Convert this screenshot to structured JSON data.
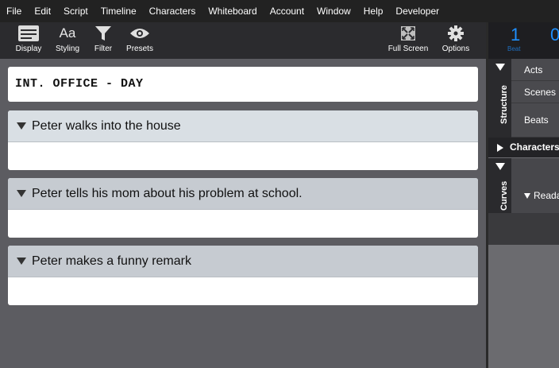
{
  "menu": [
    "File",
    "Edit",
    "Script",
    "Timeline",
    "Characters",
    "Whiteboard",
    "Account",
    "Window",
    "Help",
    "Developer"
  ],
  "toolbar": {
    "display": "Display",
    "styling": "Styling",
    "styling_icon_text": "Aa",
    "filter": "Filter",
    "presets": "Presets",
    "fullscreen": "Full Screen",
    "options": "Options"
  },
  "scene_heading": "INT. OFFICE - DAY",
  "beats": [
    "Peter walks into the house",
    "Peter tells his mom about his problem at school.",
    "Peter makes a funny remark"
  ],
  "stats": {
    "beat_count": "1",
    "second_count": "0",
    "beat_label": "Beat"
  },
  "panel": {
    "structure_tab": "Structure",
    "rows": [
      "Acts",
      "Scenes",
      "Beats"
    ],
    "characters": "Characters",
    "curves_tab": "Curves",
    "readability": "Reada"
  },
  "colors": {
    "accent": "#1e90ff",
    "editor_bg": "#5c5c61",
    "beat_header_1": "#d9dfe4",
    "beat_header_2": "#c6cbd1",
    "beat_header_3": "#c6cbd1"
  }
}
